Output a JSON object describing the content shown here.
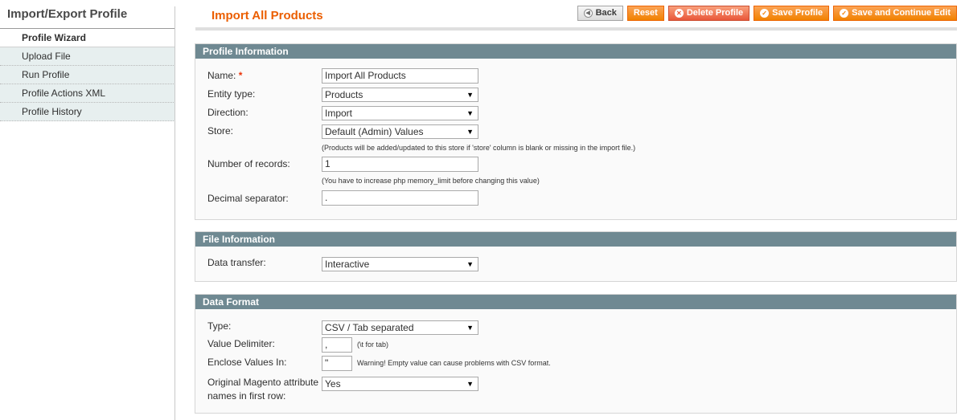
{
  "sidebar": {
    "title": "Import/Export Profile",
    "items": [
      {
        "label": "Profile Wizard"
      },
      {
        "label": "Upload File"
      },
      {
        "label": "Run Profile"
      },
      {
        "label": "Profile Actions XML"
      },
      {
        "label": "Profile History"
      }
    ]
  },
  "header": {
    "title": "Import All Products",
    "buttons": {
      "back": "Back",
      "reset": "Reset",
      "delete": "Delete Profile",
      "save": "Save Profile",
      "save_continue": "Save and Continue Edit"
    }
  },
  "profile_info": {
    "heading": "Profile Information",
    "name_label": "Name:",
    "required_mark": "*",
    "name_value": "Import All Products",
    "entity_label": "Entity type:",
    "entity_value": "Products",
    "direction_label": "Direction:",
    "direction_value": "Import",
    "store_label": "Store:",
    "store_value": "Default (Admin) Values",
    "store_note": "(Products will be added/updated to this store if 'store' column is blank or missing in the import file.)",
    "records_label": "Number of records:",
    "records_value": "1",
    "records_note": "(You have to increase php memory_limit before changing this value)",
    "decimal_label": "Decimal separator:",
    "decimal_value": "."
  },
  "file_info": {
    "heading": "File Information",
    "transfer_label": "Data transfer:",
    "transfer_value": "Interactive"
  },
  "data_format": {
    "heading": "Data Format",
    "type_label": "Type:",
    "type_value": "CSV / Tab separated",
    "delimiter_label": "Value Delimiter:",
    "delimiter_value": ",",
    "delimiter_note": "(\\t for tab)",
    "enclose_label": "Enclose Values In:",
    "enclose_value": "\"",
    "enclose_note": "Warning! Empty value can cause problems with CSV format.",
    "names_label_1": "Original Magento attribute",
    "names_label_2": "names in first row:",
    "names_value": "Yes"
  },
  "icons": {
    "dropdown": "chevron-down-icon",
    "back": "back-arrow-icon",
    "delete": "delete-icon",
    "save": "checkmark-icon"
  }
}
